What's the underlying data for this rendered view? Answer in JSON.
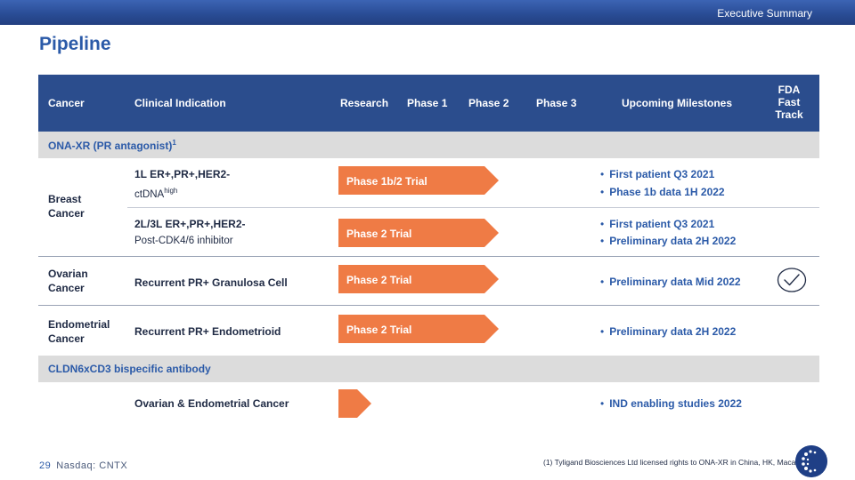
{
  "header": {
    "section_label": "Executive Summary",
    "title": "Pipeline"
  },
  "columns": {
    "cancer": "Cancer",
    "indication": "Clinical Indication",
    "research": "Research",
    "phase1": "Phase 1",
    "phase2": "Phase 2",
    "phase3": "Phase 3",
    "milestones": "Upcoming Milestones",
    "fda": [
      "FDA",
      "Fast",
      "Track"
    ]
  },
  "sections": {
    "ona": {
      "label": "ONA-XR (PR antagonist)",
      "footnote_ref": "1"
    },
    "cldn": {
      "label": "CLDN6xCD3 bispecific antibody"
    }
  },
  "rows": {
    "breast_cancer": [
      "Breast",
      "Cancer"
    ],
    "breast_1": {
      "indication": "1L ER+,PR+,HER2-",
      "sub_main": "ctDNA",
      "sub_sup": "high",
      "trial": "Phase 1b/2 Trial",
      "progress_fraction": 0.25,
      "milestones": [
        "First patient Q3 2021",
        "Phase 1b data 1H 2022"
      ]
    },
    "breast_2": {
      "indication": "2L/3L ER+,PR+,HER2-",
      "sub": "Post-CDK4/6 inhibitor",
      "trial": "Phase 2 Trial",
      "progress_fraction": 0.25,
      "milestones": [
        "First patient Q3 2021",
        "Preliminary data 2H 2022"
      ]
    },
    "ovarian": {
      "cancer": [
        "Ovarian",
        "Cancer"
      ],
      "indication": "Recurrent PR+ Granulosa Cell",
      "trial": "Phase 2 Trial",
      "progress_fraction": 0.25,
      "milestones": [
        "Preliminary data Mid 2022"
      ],
      "fda_fast_track": true
    },
    "endometrial": {
      "cancer": [
        "Endometrial",
        "Cancer"
      ],
      "indication": "Recurrent PR+ Endometrioid",
      "trial": "Phase 2 Trial",
      "progress_fraction": 0.25,
      "milestones": [
        "Preliminary data 2H 2022"
      ]
    },
    "cldn_row": {
      "indication": "Ovarian & Endometrial Cancer",
      "trial": "",
      "progress_fraction": 0.065,
      "milestones": [
        "IND enabling studies 2022"
      ]
    }
  },
  "footer": {
    "page_number": "29",
    "ticker": "Nasdaq: CNTX",
    "footnote": "(1) Tyligand Biosciences Ltd licensed rights to ONA-XR in China, HK, Macau"
  },
  "colors": {
    "header_bg": "#2b4d8d",
    "accent_blue": "#2b5aa8",
    "trial_arrow": "#ef7b45",
    "section_bg": "#dcdcdc"
  },
  "icons": {
    "fda_fast_track": "checkmark-circle-icon",
    "logo": "company-logo-icon"
  }
}
